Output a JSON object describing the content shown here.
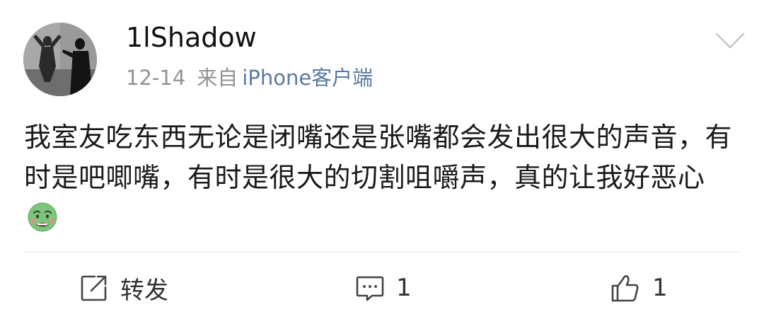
{
  "post": {
    "username": "1lShadow",
    "date": "12-14",
    "from_label": "来自",
    "client": "iPhone客户端",
    "content_text": "我室友吃东西无论是闭嘴还是张嘴都会发出很大的声音，有时是吧唧嘴，有时是很大的切割咀嚼声，真的让我好恶心",
    "content_emoji": "nauseated-face-emoji"
  },
  "actions": {
    "repost_label": "转发",
    "comment_count": "1",
    "like_count": "1"
  },
  "icons": {
    "more": "chevron-down-icon",
    "repost": "share-icon",
    "comment": "comment-icon",
    "like": "thumbs-up-icon"
  },
  "colors": {
    "username": "#111111",
    "meta_gray": "#939393",
    "client_link": "#5a7aa0",
    "body_text": "#1a1a1a",
    "divider": "#e6e6e6",
    "action_icon": "#444444"
  }
}
